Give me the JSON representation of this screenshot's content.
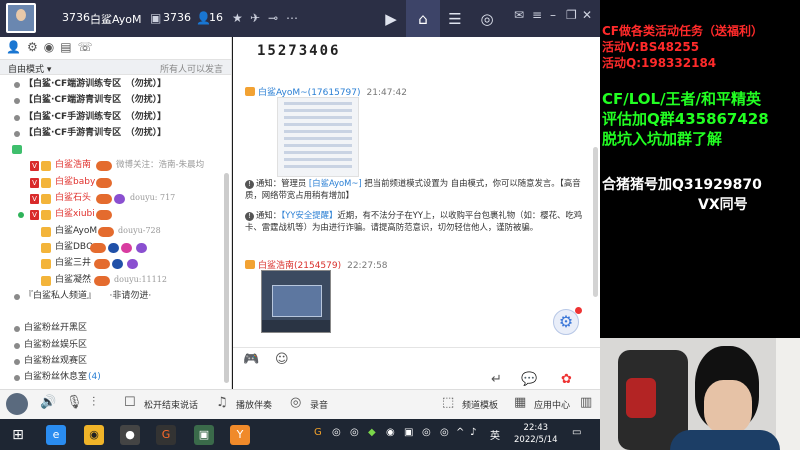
{
  "titlebar": {
    "channel_id": "3736",
    "channel_name": "白鲨AyoM",
    "badge_id": "3736",
    "member_count": "16"
  },
  "left": {
    "mode_label": "自由模式 ▾",
    "mode_hint": "所有人可以发言",
    "rows": [
      {
        "text": "【白鲨·CF端游训练专区　（勿扰）】"
      },
      {
        "text": "【白鲨·CF端游青训专区　（勿扰）】"
      },
      {
        "text": "【白鲨·CF手游训练专区　（勿扰）】"
      },
      {
        "text": "【白鲨·CF手游青训专区　（勿扰）】"
      }
    ],
    "users": [
      {
        "role": "V",
        "name": "白鲨浩南",
        "note": "微博关注：浩南-朱晨均"
      },
      {
        "role": "V",
        "name": "白鲨baby",
        "note": ""
      },
      {
        "role": "V",
        "name": "白鲨石头",
        "note": "douyu: 717"
      },
      {
        "role": "V",
        "name": "白鲨xiubi",
        "note": ""
      },
      {
        "role": "",
        "name": "白鲨AyoM",
        "note": "douyu-728"
      },
      {
        "role": "",
        "name": "白鲨DBQ",
        "note": ""
      },
      {
        "role": "",
        "name": "白鲨三井",
        "note": ""
      },
      {
        "role": "",
        "name": "白鲨凝然",
        "note": "douyu:11112"
      }
    ],
    "private_channel": "『白鲨私人频道』　　·非请勿进·",
    "fan_channels": [
      {
        "text": "白鲨粉丝开黑区"
      },
      {
        "text": "白鲨粉丝娱乐区"
      },
      {
        "text": "白鲨粉丝观赛区"
      },
      {
        "text": "白鲨粉丝休息室",
        "count": "(4)"
      }
    ]
  },
  "chat": {
    "pinned_number": "15273406",
    "msg1_name": "白鲨AyoM~(17615797)",
    "msg1_time": "21:47:42",
    "notice1_prefix": "通知：管理员",
    "notice1_admin": "[白鲨AyoM~]",
    "notice1_rest": "把当前频道模式设置为 自由模式，你可以随意发言。【高音质，网络带宽占用稍有增加】",
    "notice2_prefix": "通知：",
    "notice2_link": "【YY安全提醒】",
    "notice2_rest": "近期，有不法分子在YY上，以收购平台包裹礼物（如：樱花、吃鸡卡、雷霆战机等）为由进行诈骗。请提高防范意识，切勿轻信他人，谨防被骗。",
    "msg2_name": "白鲨浩南(2154579)",
    "msg2_time": "22:27:58"
  },
  "bottombar": {
    "mic_mode": "松开结束说话",
    "play_music": "播放伴奏",
    "record": "录音",
    "channel_template": "频道模板",
    "app_center": "应用中心"
  },
  "taskbar": {
    "ime": "英",
    "time": "22:43",
    "date": "2022/5/14"
  },
  "promo": {
    "l1": "CF做各类活动任务（送福利）",
    "l2": "活动V:BS48255",
    "l3": "活动Q:198332184",
    "l4": "CF/LOL/王者/和平精英",
    "l5": "评估加Q群435867428",
    "l6": "脱坑入坑加群了解",
    "l7": "合猪猪号加Q31929870",
    "l8": "VX同号"
  },
  "colors": {
    "promo_red": "#ff2a2a",
    "promo_green": "#22ff22",
    "promo_white": "#ffffff",
    "link_blue": "#2a7fd4",
    "username_red": "#e0302c"
  }
}
